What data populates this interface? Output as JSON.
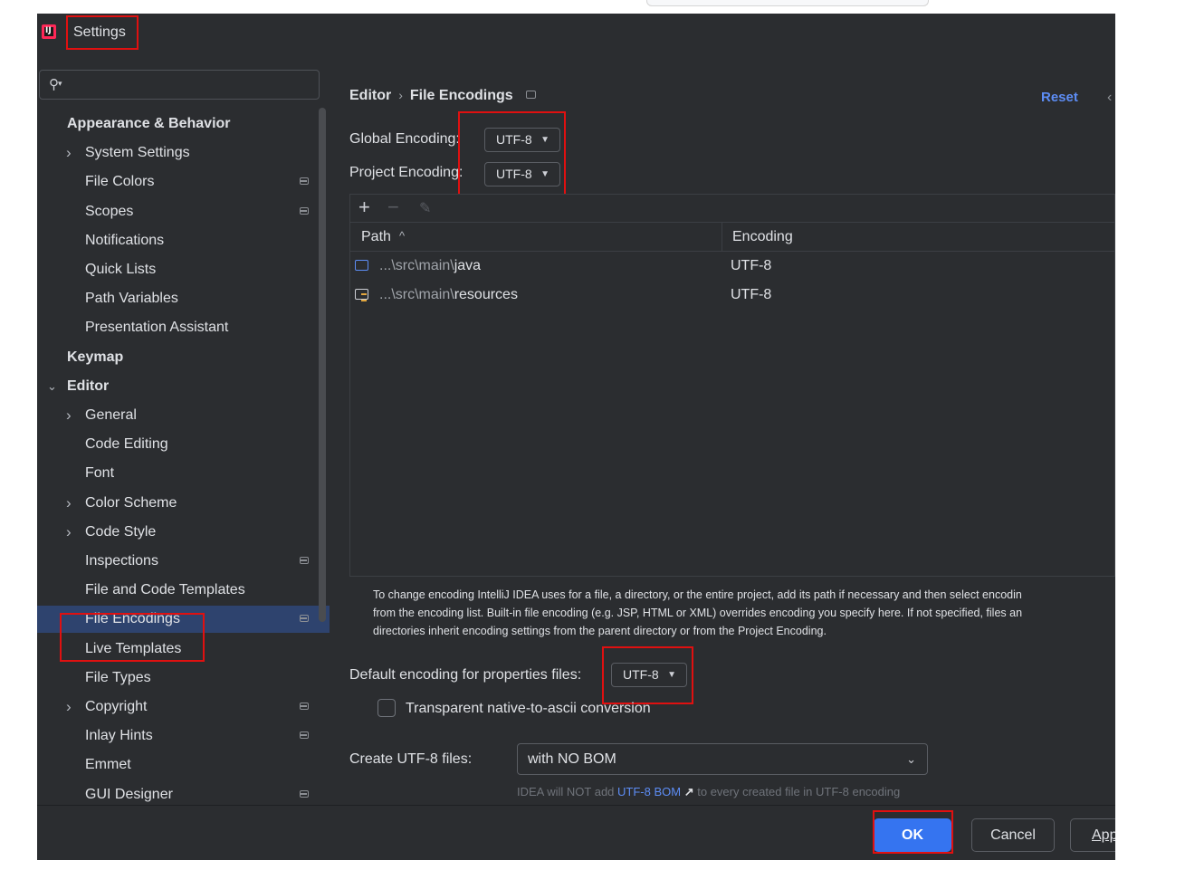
{
  "window": {
    "title": "Settings"
  },
  "sidebar": {
    "search_placeholder": "",
    "items": [
      {
        "label": "Appearance & Behavior",
        "bold": true
      },
      {
        "label": "System Settings",
        "expandable": true
      },
      {
        "label": "File Colors",
        "badge": true
      },
      {
        "label": "Scopes",
        "badge": true
      },
      {
        "label": "Notifications"
      },
      {
        "label": "Quick Lists"
      },
      {
        "label": "Path Variables"
      },
      {
        "label": "Presentation Assistant"
      },
      {
        "label": "Keymap",
        "bold": true
      },
      {
        "label": "Editor",
        "bold": true,
        "expanded": true
      },
      {
        "label": "General",
        "expandable": true
      },
      {
        "label": "Code Editing"
      },
      {
        "label": "Font"
      },
      {
        "label": "Color Scheme",
        "expandable": true
      },
      {
        "label": "Code Style",
        "expandable": true
      },
      {
        "label": "Inspections",
        "badge": true
      },
      {
        "label": "File and Code Templates"
      },
      {
        "label": "File Encodings",
        "badge": true,
        "selected": true
      },
      {
        "label": "Live Templates"
      },
      {
        "label": "File Types"
      },
      {
        "label": "Copyright",
        "expandable": true,
        "badge": true
      },
      {
        "label": "Inlay Hints",
        "badge": true
      },
      {
        "label": "Emmet"
      },
      {
        "label": "GUI Designer",
        "badge": true
      }
    ],
    "help_label": "?"
  },
  "main": {
    "breadcrumb": {
      "parent": "Editor",
      "separator": "›",
      "current": "File Encodings"
    },
    "reset_label": "Reset",
    "global_encoding_label": "Global Encoding:",
    "global_encoding_value": "UTF-8",
    "project_encoding_label": "Project Encoding:",
    "project_encoding_value": "UTF-8",
    "table": {
      "columns": [
        "Path",
        "Encoding"
      ],
      "sort_indicator": "^",
      "rows": [
        {
          "path_prefix": "...\\src\\main\\",
          "path_leaf": "java",
          "encoding": "UTF-8"
        },
        {
          "path_prefix": "...\\src\\main\\",
          "path_leaf": "resources",
          "encoding": "UTF-8"
        }
      ]
    },
    "help_lines": [
      "To change encoding IntelliJ IDEA uses for a file, a directory, or the entire project, add its path if necessary and then select encodin",
      "from the encoding list. Built-in file encoding (e.g. JSP, HTML or XML) overrides encoding you specify here. If not specified, files an",
      "directories inherit encoding settings from the parent directory or from the Project Encoding."
    ],
    "properties_label": "Default encoding for properties files:",
    "properties_value": "UTF-8",
    "native_ascii_label": "Transparent native-to-ascii conversion",
    "native_ascii_checked": false,
    "create_utf8_label": "Create UTF-8 files:",
    "create_utf8_value": "with NO BOM",
    "bom_hint_pre": "IDEA will NOT add ",
    "bom_hint_link": "UTF-8 BOM",
    "bom_hint_arrow": "↗",
    "bom_hint_post": " to every created file in UTF-8 encoding"
  },
  "buttons": {
    "ok": "OK",
    "cancel": "Cancel",
    "apply": "Apply"
  },
  "colors": {
    "accent": "#3574f0",
    "selection": "#2e436e",
    "link": "#5d8df5",
    "highlight": "#e01010"
  }
}
